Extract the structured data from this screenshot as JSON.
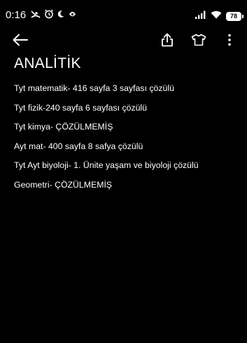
{
  "status_bar": {
    "time": "0:16",
    "battery": "78",
    "left_icons": [
      "missed-call-icon",
      "alarm-icon",
      "moon-icon",
      "notification-icon"
    ],
    "right_icons": [
      "signal-icon",
      "wifi-icon",
      "battery-icon"
    ]
  },
  "toolbar": {
    "icons": [
      "back-arrow-icon",
      "share-icon",
      "shirt-icon",
      "more-vert-icon"
    ]
  },
  "note": {
    "title": "ANALİTİK",
    "lines": [
      "Tyt matematik- 416 sayfa 3 sayfası çözülü",
      "Tyt fizik-240 sayfa 6 sayfası çözülü",
      "Tyt kimya- ÇÖZÜLMEMİŞ",
      "Ayt mat- 400 sayfa 8 safya çözülü",
      "Tyt Ayt biyoloji- 1. Ünite yaşam ve biyoloji çözülü",
      "Geometri- ÇÖZÜLMEMİŞ"
    ]
  },
  "colors": {
    "background": "#000000",
    "text": "#ffffff"
  }
}
